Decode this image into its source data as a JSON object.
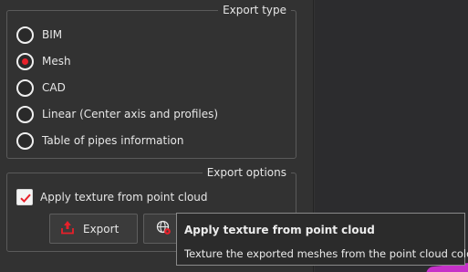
{
  "export_type": {
    "title": "Export type",
    "options": [
      {
        "label": "BIM",
        "selected": false
      },
      {
        "label": "Mesh",
        "selected": true
      },
      {
        "label": "CAD",
        "selected": false
      },
      {
        "label": "Linear (Center axis and profiles)",
        "selected": false
      },
      {
        "label": "Table of pipes information",
        "selected": false
      }
    ]
  },
  "export_options": {
    "title": "Export options",
    "apply_texture": {
      "label": "Apply texture from point cloud",
      "checked": true
    },
    "export_button": {
      "label": "Export",
      "icon": "export-arrow-icon"
    },
    "settings_button": {
      "icon": "globe-settings-icon"
    }
  },
  "tooltip": {
    "title": "Apply texture from point cloud",
    "body": "Texture the exported meshes from the point cloud colors"
  },
  "colors": {
    "accent": "#e8202a",
    "point_cloud": "#c531c8"
  }
}
